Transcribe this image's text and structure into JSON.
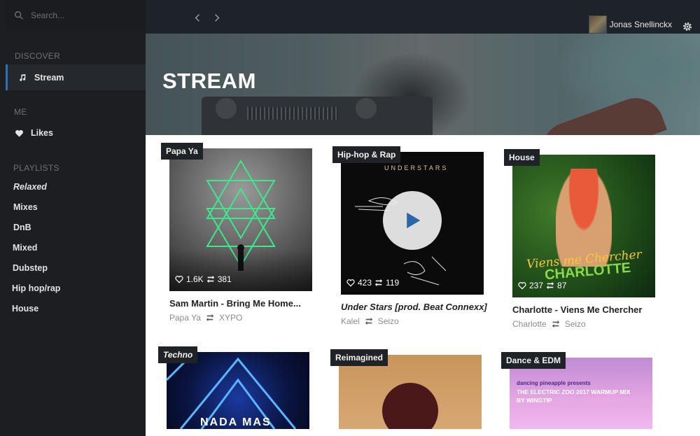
{
  "search": {
    "placeholder": "Search..."
  },
  "sidebar": {
    "discover_label": "DISCOVER",
    "stream_label": "Stream",
    "me_label": "ME",
    "likes_label": "Likes",
    "playlists_label": "PLAYLISTS",
    "playlists": [
      "Relaxed",
      "Mixes",
      "DnB",
      "Mixed",
      "Dubstep",
      "Hip hop/rap",
      "House"
    ]
  },
  "topbar": {
    "username": "Jonas Snellinckx"
  },
  "hero": {
    "title": "STREAM"
  },
  "cards": [
    {
      "tag": "Papa Ya",
      "likes": "1.6K",
      "reposts": "381",
      "title": "Sam Martin - Bring Me Home...",
      "artist": "Papa Ya",
      "reposter": "XYPO"
    },
    {
      "tag": "Hip-hop & Rap",
      "likes": "423",
      "reposts": "119",
      "title": "Under Stars [prod. Beat Connexx]",
      "artist": "Kalel",
      "reposter": "Seizo",
      "art_text": "UNDERSTARS"
    },
    {
      "tag": "House",
      "likes": "237",
      "reposts": "87",
      "title": "Charlotte - Viens Me Chercher",
      "artist": "Charlotte",
      "reposter": "Seizo",
      "art_text_1": "Viens me Chercher",
      "art_text_2": "CHARLOTTE"
    },
    {
      "tag": "Techno",
      "art_text": "NADA MAS"
    },
    {
      "tag": "Reimagined"
    },
    {
      "tag": "Dance & EDM",
      "art_text_1": "dancing pineapple presents",
      "art_text_2": "THE ELECTRIC ZOO 2017 WARMUP MIX",
      "art_text_3": "BY WINGTIP"
    }
  ],
  "colors": {
    "sidebar": "#1c1e22",
    "topbar": "#1e2229",
    "accent": "#2f6fbe"
  }
}
